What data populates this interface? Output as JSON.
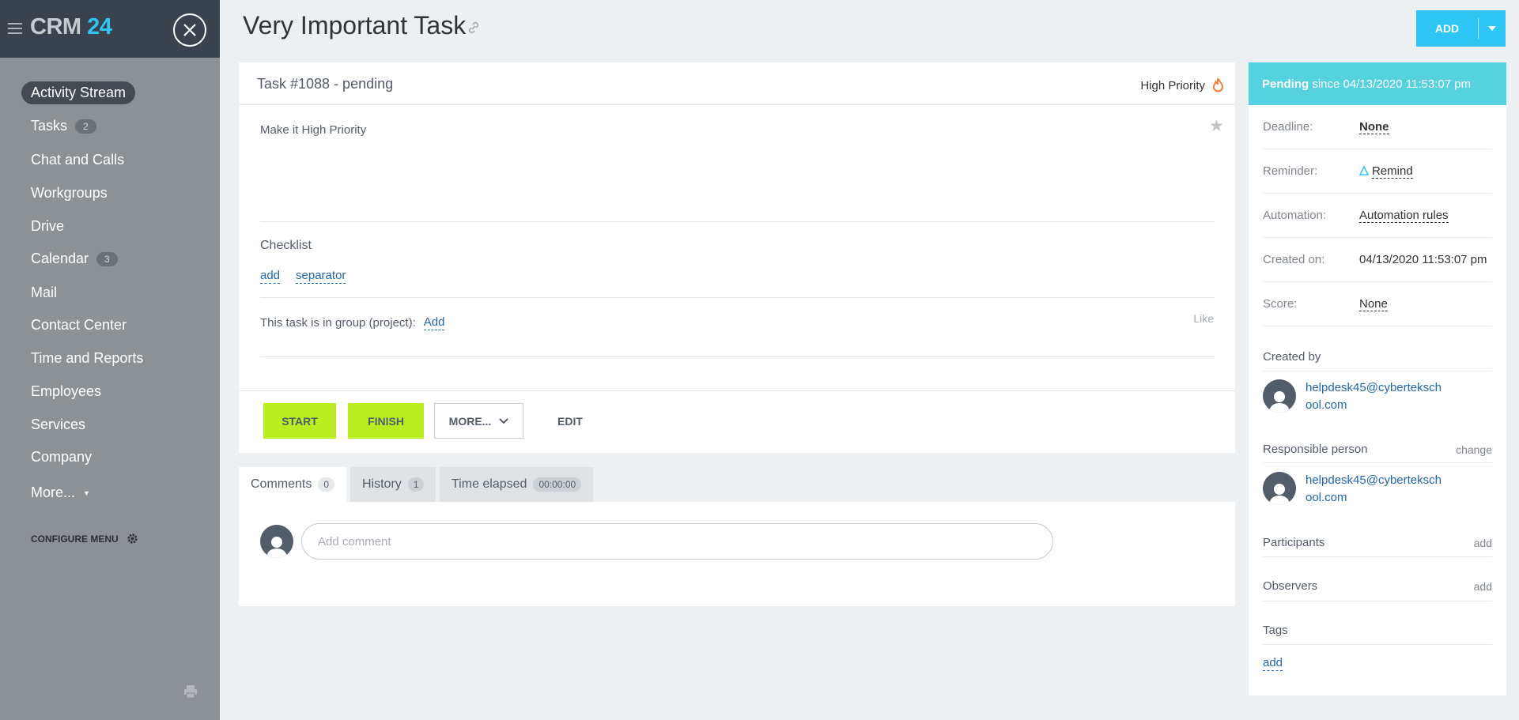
{
  "sidebar": {
    "logo_text": "CRM",
    "logo_num": "24",
    "items": [
      {
        "label": "Activity Stream",
        "count": null
      },
      {
        "label": "Tasks",
        "count": "2"
      },
      {
        "label": "Chat and Calls",
        "count": null
      },
      {
        "label": "Workgroups",
        "count": null
      },
      {
        "label": "Drive",
        "count": null
      },
      {
        "label": "Calendar",
        "count": "3"
      },
      {
        "label": "Mail",
        "count": null
      },
      {
        "label": "Contact Center",
        "count": null
      },
      {
        "label": "Time and Reports",
        "count": null
      },
      {
        "label": "Employees",
        "count": null
      },
      {
        "label": "Services",
        "count": null
      },
      {
        "label": "Company",
        "count": null
      },
      {
        "label": "More...",
        "count": null
      }
    ],
    "configure": "CONFIGURE MENU"
  },
  "header": {
    "title": "Very Important Task",
    "add_label": "ADD"
  },
  "task": {
    "id_line": "Task #1088 - pending",
    "priority": "High Priority",
    "description": "Make it High Priority",
    "checklist_title": "Checklist",
    "checklist_add": "add",
    "checklist_separator": "separator",
    "group_text": "This task is in group (project):",
    "group_add": "Add",
    "like": "Like"
  },
  "buttons": {
    "start": "START",
    "finish": "FINISH",
    "more": "MORE...",
    "edit": "EDIT"
  },
  "tabs": [
    {
      "label": "Comments",
      "count": "0"
    },
    {
      "label": "History",
      "count": "1"
    },
    {
      "label": "Time elapsed",
      "count": "00:00:00"
    }
  ],
  "comment": {
    "placeholder": "Add comment"
  },
  "panel": {
    "status_bold": "Pending",
    "status_rest": "since 04/13/2020 11:53:07 pm",
    "rows": [
      {
        "label": "Deadline:",
        "value": "None"
      },
      {
        "label": "Reminder:",
        "value": "Remind"
      },
      {
        "label": "Automation:",
        "value": "Automation rules"
      },
      {
        "label": "Created on:",
        "value": "04/13/2020 11:53:07 pm"
      },
      {
        "label": "Score:",
        "value": "None"
      }
    ],
    "created_by_label": "Created by",
    "created_by_email": "helpdesk45@cybertekschool.com",
    "responsible_label": "Responsible person",
    "responsible_change": "change",
    "responsible_email": "helpdesk45@cybertekschool.com",
    "participants_label": "Participants",
    "participants_add": "add",
    "observers_label": "Observers",
    "observers_add": "add",
    "tags_label": "Tags",
    "tags_add": "add"
  },
  "colors": {
    "sidebar_top": "#39424d",
    "sidebar": "#8c9196",
    "accent": "#2fc6f6",
    "status_header": "#56d1e0",
    "green_button": "#bbed21",
    "link": "#2067b0"
  }
}
